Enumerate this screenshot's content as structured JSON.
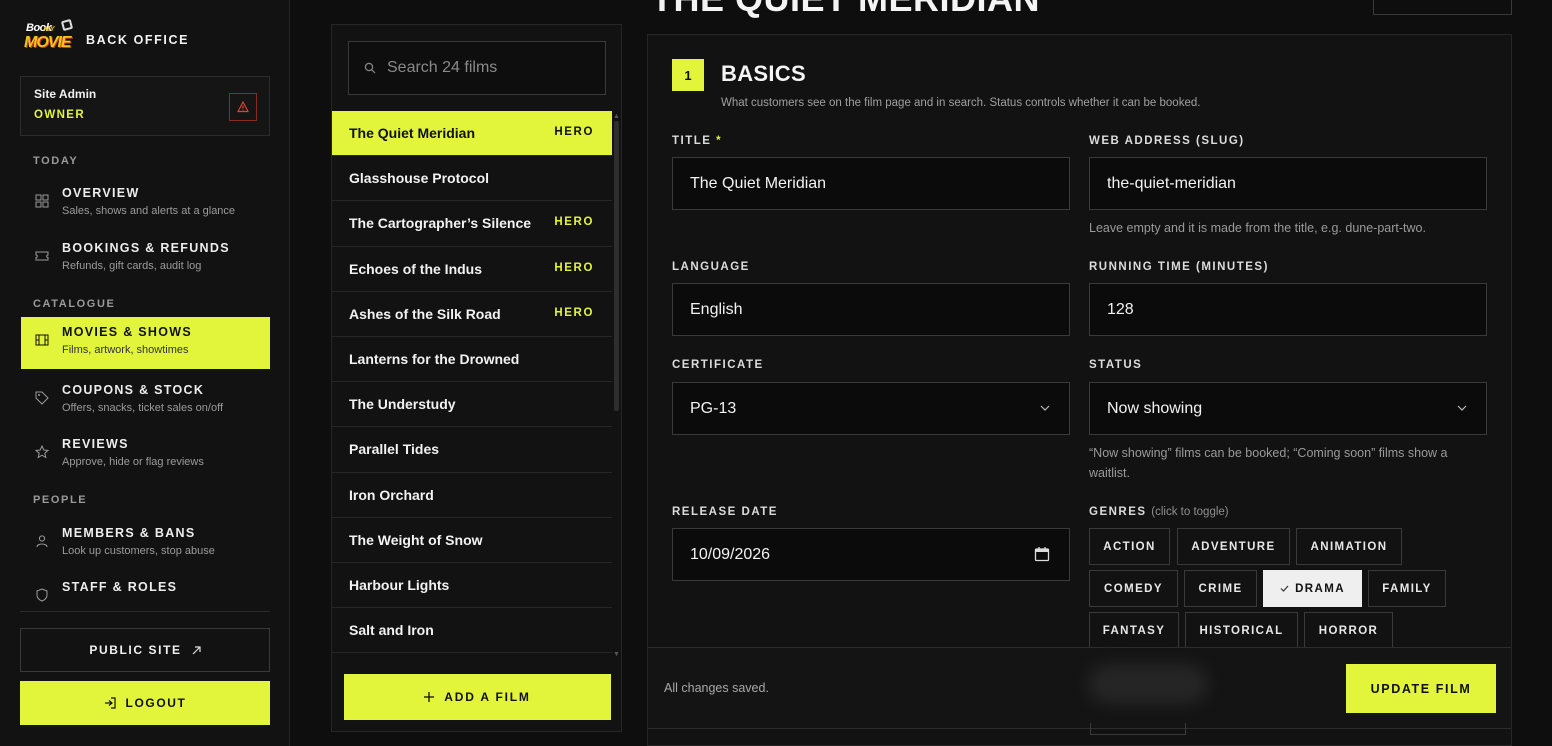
{
  "brand": {
    "logo_text_1": "Book",
    "logo_text_2": "MY",
    "logo_text_3": "MOVIE",
    "name": "BACK OFFICE"
  },
  "user": {
    "name": "Site Admin",
    "role": "OWNER"
  },
  "colors": {
    "accent": "#e2f53b",
    "background": "#0e0e0e",
    "panel": "#121212",
    "alert": "#c0392b"
  },
  "nav": {
    "sections": [
      {
        "label": "TODAY"
      },
      {
        "label": "CATALOGUE"
      },
      {
        "label": "PEOPLE"
      }
    ],
    "items": [
      {
        "title": "OVERVIEW",
        "subtitle": "Sales, shows and alerts at a glance",
        "icon": "grid-icon"
      },
      {
        "title": "BOOKINGS & REFUNDS",
        "subtitle": "Refunds, gift cards, audit log",
        "icon": "ticket-icon"
      },
      {
        "title": "MOVIES & SHOWS",
        "subtitle": "Films, artwork, showtimes",
        "icon": "film-icon",
        "active": true
      },
      {
        "title": "COUPONS & STOCK",
        "subtitle": "Offers, snacks, ticket sales on/off",
        "icon": "tag-icon"
      },
      {
        "title": "REVIEWS",
        "subtitle": "Approve, hide or flag reviews",
        "icon": "star-icon"
      },
      {
        "title": "MEMBERS & BANS",
        "subtitle": "Look up customers, stop abuse",
        "icon": "user-icon"
      },
      {
        "title": "STAFF & ROLES",
        "subtitle": "",
        "icon": "shield-icon"
      }
    ],
    "public_site": "PUBLIC SITE",
    "logout": "LOGOUT"
  },
  "films": {
    "search_placeholder": "Search 24 films",
    "items": [
      {
        "name": "The Quiet Meridian",
        "badge": "HERO",
        "selected": true
      },
      {
        "name": "Glasshouse Protocol",
        "badge": ""
      },
      {
        "name": "The Cartographer’s Silence",
        "badge": "HERO"
      },
      {
        "name": "Echoes of the Indus",
        "badge": "HERO"
      },
      {
        "name": "Ashes of the Silk Road",
        "badge": "HERO"
      },
      {
        "name": "Lanterns for the Drowned",
        "badge": ""
      },
      {
        "name": "The Understudy",
        "badge": ""
      },
      {
        "name": "Parallel Tides",
        "badge": ""
      },
      {
        "name": "Iron Orchard",
        "badge": ""
      },
      {
        "name": "The Weight of Snow",
        "badge": ""
      },
      {
        "name": "Harbour Lights",
        "badge": ""
      },
      {
        "name": "Salt and Iron",
        "badge": ""
      }
    ],
    "add_label": "ADD A FILM"
  },
  "editor": {
    "page_title": "THE QUIET MERIDIAN",
    "step_number": "1",
    "section_title": "BASICS",
    "section_desc": "What customers see on the film page and in search. Status controls whether it can be booked.",
    "title_label": "TITLE",
    "title_required": "*",
    "title_value": "The Quiet Meridian",
    "slug_label": "WEB ADDRESS (SLUG)",
    "slug_value": "the-quiet-meridian",
    "slug_help": "Leave empty and it is made from the title, e.g. dune-part-two.",
    "language_label": "LANGUAGE",
    "language_value": "English",
    "runtime_label": "RUNNING TIME (MINUTES)",
    "runtime_value": "128",
    "certificate_label": "CERTIFICATE",
    "certificate_value": "PG-13",
    "status_label": "STATUS",
    "status_value": "Now showing",
    "status_help": "“Now showing” films can be booked; “Coming soon” films show a waitlist.",
    "release_label": "RELEASE DATE",
    "release_value": "10/09/2026",
    "genres_label": "GENRES",
    "genres_hint": "(click to toggle)",
    "genres": [
      {
        "label": "ACTION",
        "on": false
      },
      {
        "label": "ADVENTURE",
        "on": false
      },
      {
        "label": "ANIMATION",
        "on": false
      },
      {
        "label": "COMEDY",
        "on": false
      },
      {
        "label": "CRIME",
        "on": false
      },
      {
        "label": "DRAMA",
        "on": true
      },
      {
        "label": "FAMILY",
        "on": false
      },
      {
        "label": "FANTASY",
        "on": false
      },
      {
        "label": "HISTORICAL",
        "on": false
      },
      {
        "label": "HORROR",
        "on": false
      }
    ],
    "save_status": "All changes saved.",
    "update_label": "UPDATE FILM"
  }
}
